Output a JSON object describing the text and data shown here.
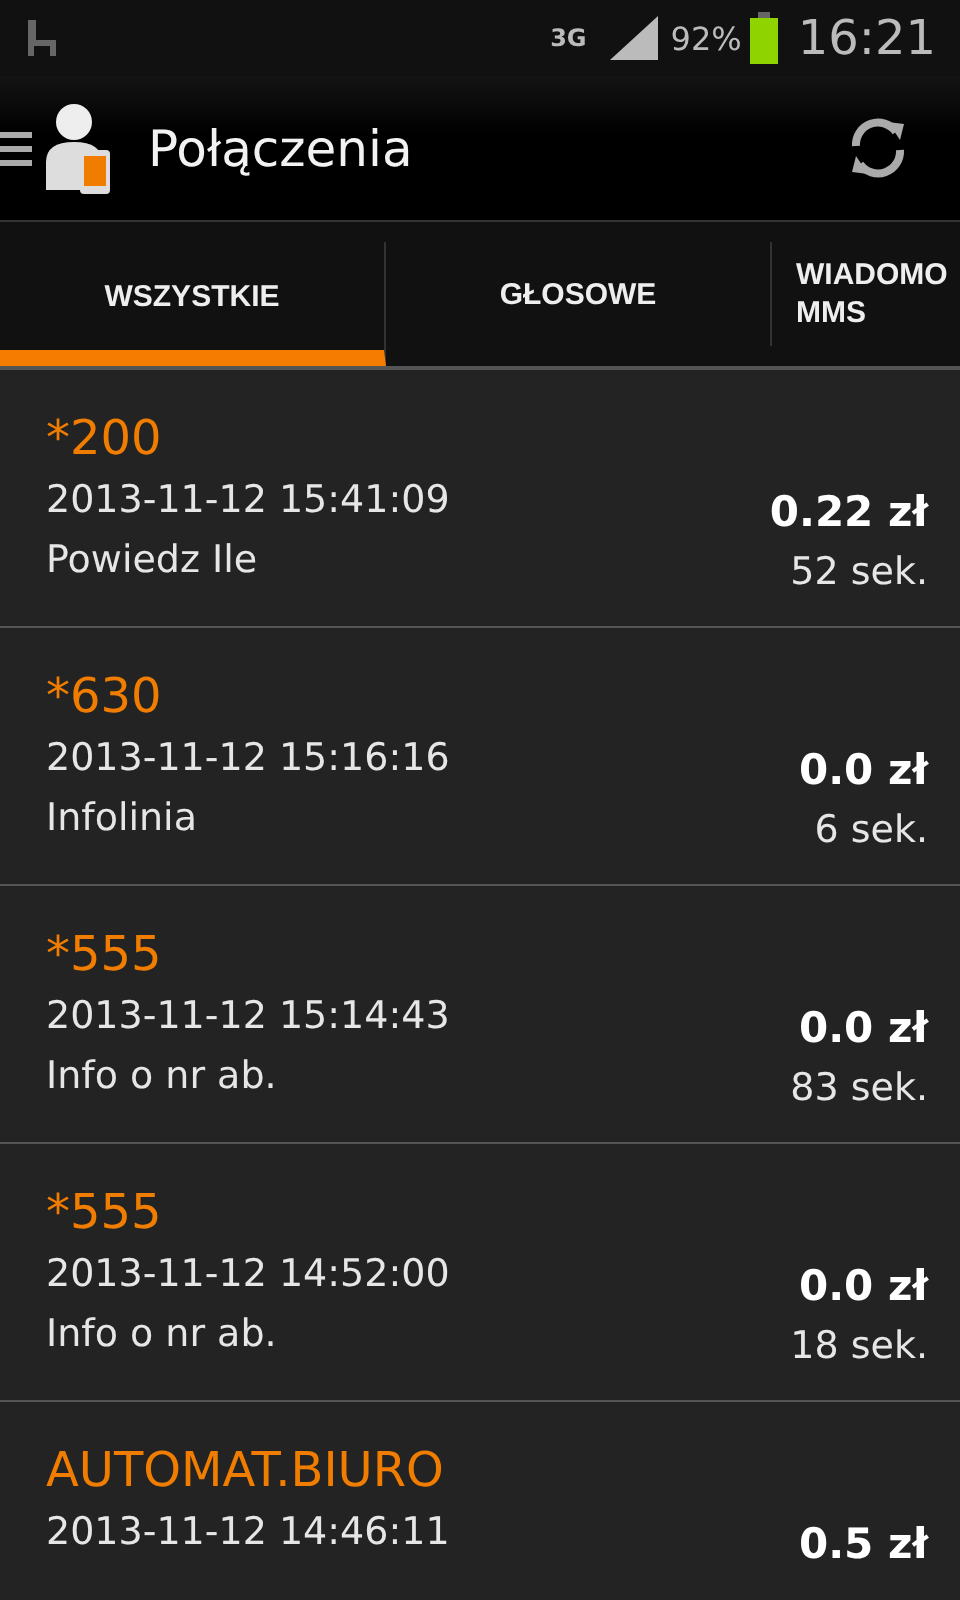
{
  "status_bar": {
    "network": "3G",
    "battery": "92%",
    "time": "16:21"
  },
  "app_bar": {
    "title": "Połączenia"
  },
  "tabs": [
    {
      "label": "WSZYSTKIE",
      "selected": true
    },
    {
      "label": "GŁOSOWE",
      "selected": false
    },
    {
      "label": "WIADOMO MMS",
      "selected": false
    }
  ],
  "calls": [
    {
      "number": "*200",
      "datetime": "2013-11-12 15:41:09",
      "description": "Powiedz Ile",
      "cost": "0.22 zł",
      "duration": "52 sek."
    },
    {
      "number": "*630",
      "datetime": "2013-11-12 15:16:16",
      "description": "Infolinia",
      "cost": "0.0 zł",
      "duration": "6 sek."
    },
    {
      "number": "*555",
      "datetime": "2013-11-12 15:14:43",
      "description": "Info o nr ab.",
      "cost": "0.0 zł",
      "duration": "83 sek."
    },
    {
      "number": "*555",
      "datetime": "2013-11-12 14:52:00",
      "description": "Info o nr ab.",
      "cost": "0.0 zł",
      "duration": "18 sek."
    },
    {
      "number": "AUTOMAT.BIURO",
      "datetime": "2013-11-12 14:46:11",
      "cost": "0.5 zł"
    }
  ]
}
